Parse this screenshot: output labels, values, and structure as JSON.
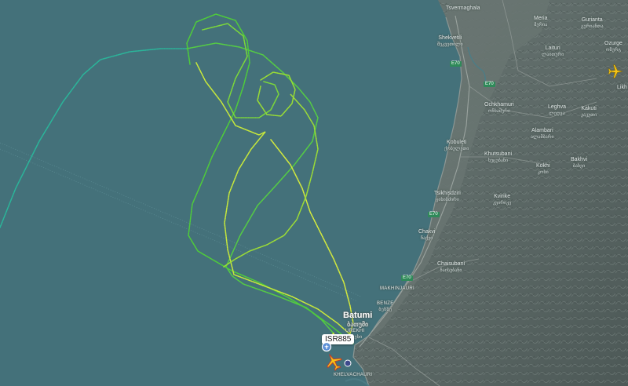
{
  "map": {
    "colors": {
      "sea": "#44717a",
      "land": "#5b6865",
      "track_start": "#2bb59a",
      "track_mid": "#5fd23a",
      "track_end": "#e8ef3c"
    },
    "place_labels": [
      {
        "id": "tsvermaghala",
        "name": "Tsvermaghala",
        "ka": ""
      },
      {
        "id": "meria",
        "name": "Meria",
        "ka": "მერია"
      },
      {
        "id": "gurianta",
        "name": "Gurianta",
        "ka": "გურიანთა"
      },
      {
        "id": "ozurgeti",
        "name": "Ozurge",
        "ka": "ოზურგ"
      },
      {
        "id": "shekvetili",
        "name": "Shekvetili",
        "ka": "შეკვეთილი"
      },
      {
        "id": "laituri",
        "name": "Laituri",
        "ka": "ლაითური"
      },
      {
        "id": "likhauri",
        "name": "Likh",
        "ka": ""
      },
      {
        "id": "ochkhamuri",
        "name": "Ochkhamuri",
        "ka": "ოჩხამური"
      },
      {
        "id": "leghva",
        "name": "Leghva",
        "ka": "ლეღვა"
      },
      {
        "id": "kakuti",
        "name": "Kakuti",
        "ka": "კაკუთი"
      },
      {
        "id": "alambari",
        "name": "Alambari",
        "ka": "ალამბარი"
      },
      {
        "id": "kobuleti",
        "name": "Kobuleti",
        "ka": "ქობულეთი"
      },
      {
        "id": "khutsubani",
        "name": "Khutsubani",
        "ka": "ხუცუბანი"
      },
      {
        "id": "kokhi",
        "name": "Kokhi",
        "ka": "კოხი"
      },
      {
        "id": "bakhvi",
        "name": "Bakhvi",
        "ka": "ბახვი"
      },
      {
        "id": "tsikhisdziri",
        "name": "Tsikhisdziri",
        "ka": "ციხისძირი"
      },
      {
        "id": "kvirike",
        "name": "Kvirike",
        "ka": "კვირიკე"
      },
      {
        "id": "chakvi",
        "name": "Chakvi",
        "ka": "ჩაქვი"
      },
      {
        "id": "chaisubani",
        "name": "Chaisubani",
        "ka": "ჩაისუბანი"
      },
      {
        "id": "makhinjauri",
        "name": "MAKHINJAURI",
        "ka": ""
      },
      {
        "id": "benze",
        "name": "BENZE",
        "ka": "ბენზე"
      },
      {
        "id": "batumi",
        "name": "Batumi",
        "ka": "ბათუმი"
      },
      {
        "id": "urekhi",
        "name": "UREKHI",
        "ka": "ურეხი"
      },
      {
        "id": "khelvachauri",
        "name": "KHELVACHAURI",
        "ka": ""
      }
    ],
    "road_badges": [
      "E70",
      "E70",
      "E70",
      "E70"
    ],
    "flight": {
      "callsign": "ISR885"
    },
    "aircraft_icon": "airplane-icon"
  }
}
